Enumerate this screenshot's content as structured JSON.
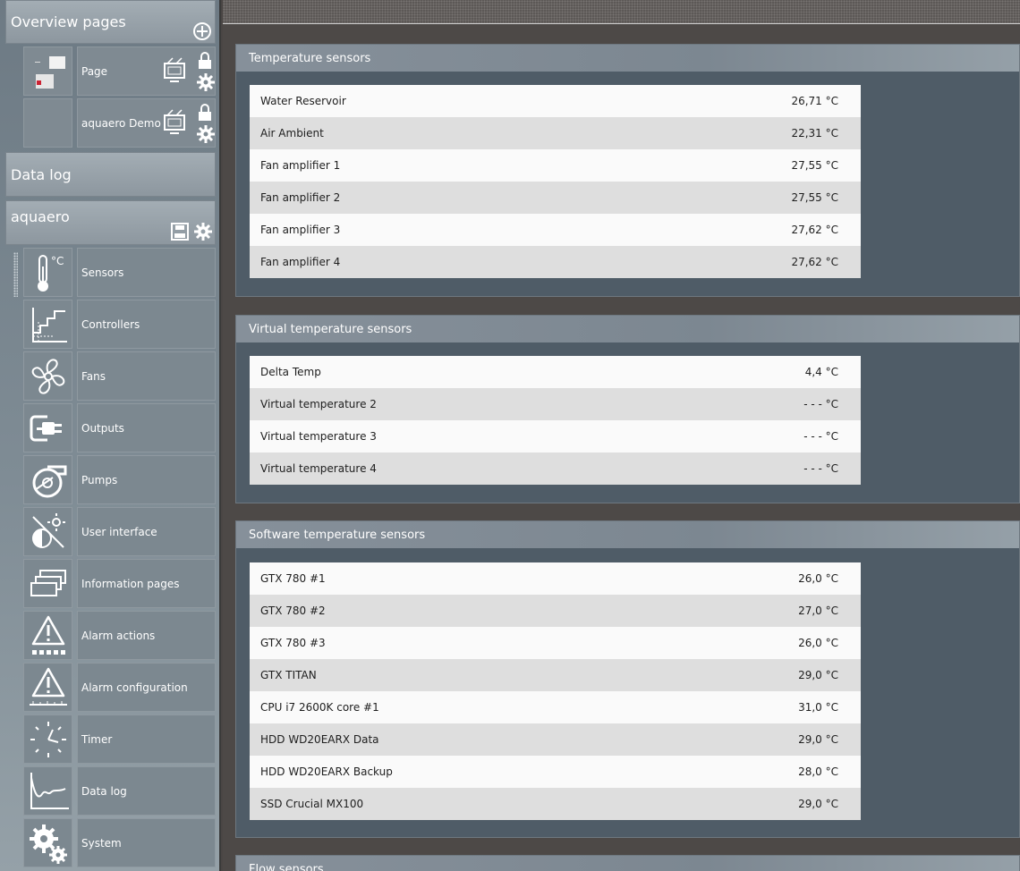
{
  "sidebar": {
    "overview": {
      "title": "Overview pages",
      "pages": [
        {
          "label": "Page"
        },
        {
          "label": "aquaero Demo"
        }
      ]
    },
    "datalog_header": {
      "title": "Data log"
    },
    "device": {
      "title": "aquaero"
    },
    "nav": [
      {
        "label": "Sensors",
        "icon": "thermometer-icon",
        "unit": "°C"
      },
      {
        "label": "Controllers",
        "icon": "controller-icon"
      },
      {
        "label": "Fans",
        "icon": "fan-icon"
      },
      {
        "label": "Outputs",
        "icon": "plug-icon"
      },
      {
        "label": "Pumps",
        "icon": "pump-icon"
      },
      {
        "label": "User interface",
        "icon": "contrast-brightness-icon"
      },
      {
        "label": "Information pages",
        "icon": "pages-stack-icon"
      },
      {
        "label": "Alarm actions",
        "icon": "alarm-actions-icon"
      },
      {
        "label": "Alarm configuration",
        "icon": "alarm-config-icon"
      },
      {
        "label": "Timer",
        "icon": "clock-icon"
      },
      {
        "label": "Data log",
        "icon": "graph-icon"
      },
      {
        "label": "System",
        "icon": "gears-icon"
      }
    ]
  },
  "main": {
    "temperature": {
      "title": "Temperature sensors",
      "rows": [
        {
          "name": "Water Reservoir",
          "value": "26,71 °C"
        },
        {
          "name": "Air Ambient",
          "value": "22,31 °C"
        },
        {
          "name": "Fan amplifier 1",
          "value": "27,55 °C"
        },
        {
          "name": "Fan amplifier 2",
          "value": "27,55 °C"
        },
        {
          "name": "Fan amplifier 3",
          "value": "27,62 °C"
        },
        {
          "name": "Fan amplifier 4",
          "value": "27,62 °C"
        }
      ]
    },
    "virtual": {
      "title": "Virtual temperature sensors",
      "rows": [
        {
          "name": "Delta Temp",
          "value": "4,4 °C"
        },
        {
          "name": "Virtual temperature 2",
          "value": "- - - °C"
        },
        {
          "name": "Virtual temperature 3",
          "value": "- - - °C"
        },
        {
          "name": "Virtual temperature 4",
          "value": "- - - °C"
        }
      ]
    },
    "software": {
      "title": "Software temperature sensors",
      "rows": [
        {
          "name": "GTX 780 #1",
          "value": "26,0 °C"
        },
        {
          "name": "GTX 780 #2",
          "value": "27,0 °C"
        },
        {
          "name": "GTX 780 #3",
          "value": "26,0 °C"
        },
        {
          "name": "GTX TITAN",
          "value": "29,0 °C"
        },
        {
          "name": "CPU i7 2600K core #1",
          "value": "31,0 °C"
        },
        {
          "name": "HDD WD20EARX Data",
          "value": "29,0 °C"
        },
        {
          "name": "HDD WD20EARX Backup",
          "value": "28,0 °C"
        },
        {
          "name": "SSD Crucial MX100",
          "value": "29,0 °C"
        }
      ]
    },
    "flow": {
      "title": "Flow sensors"
    }
  }
}
